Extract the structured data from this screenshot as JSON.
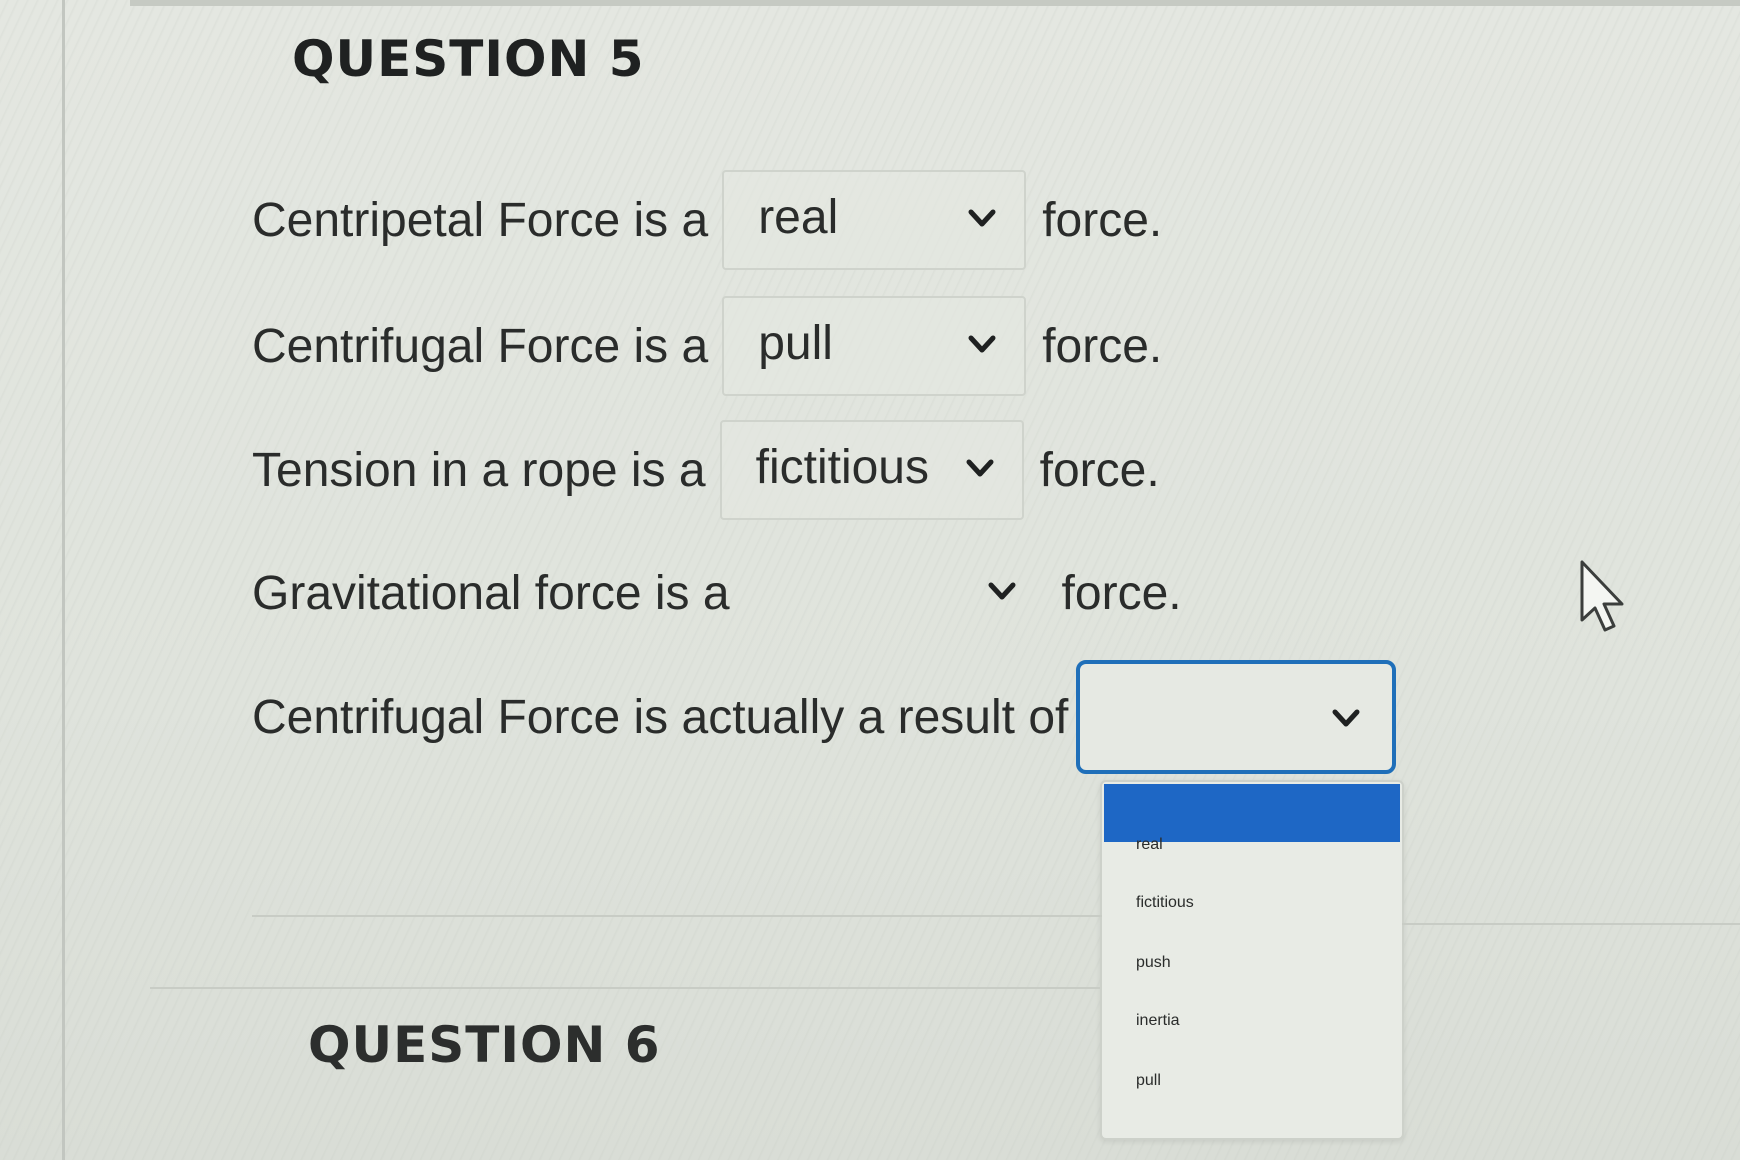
{
  "question5": {
    "title": "QUESTION 5",
    "rows": [
      {
        "prompt": "Centripetal Force is a",
        "selected": "real",
        "suffix": "force."
      },
      {
        "prompt": "Centrifugal Force is a",
        "selected": "pull",
        "suffix": "force."
      },
      {
        "prompt": "Tension in a rope is a",
        "selected": "fictitious",
        "suffix": "force."
      },
      {
        "prompt": "Gravitational force is a",
        "selected": "",
        "suffix": "force."
      },
      {
        "prompt": "Centrifugal Force is actually a result of",
        "selected": "",
        "suffix": ""
      }
    ],
    "dropdown_options": [
      "real",
      "fictitious",
      "push",
      "inertia",
      "pull"
    ],
    "dropdown_highlighted": ""
  },
  "question6": {
    "title": "QUESTION 6"
  },
  "colors": {
    "focus_border": "#1f6fb9",
    "highlight": "#1e67c5",
    "background": "#dfe3dc",
    "text": "#2a2c2b"
  },
  "icons": {
    "select_chevron": "chevron-down-icon",
    "pointer": "mouse-pointer-icon"
  }
}
